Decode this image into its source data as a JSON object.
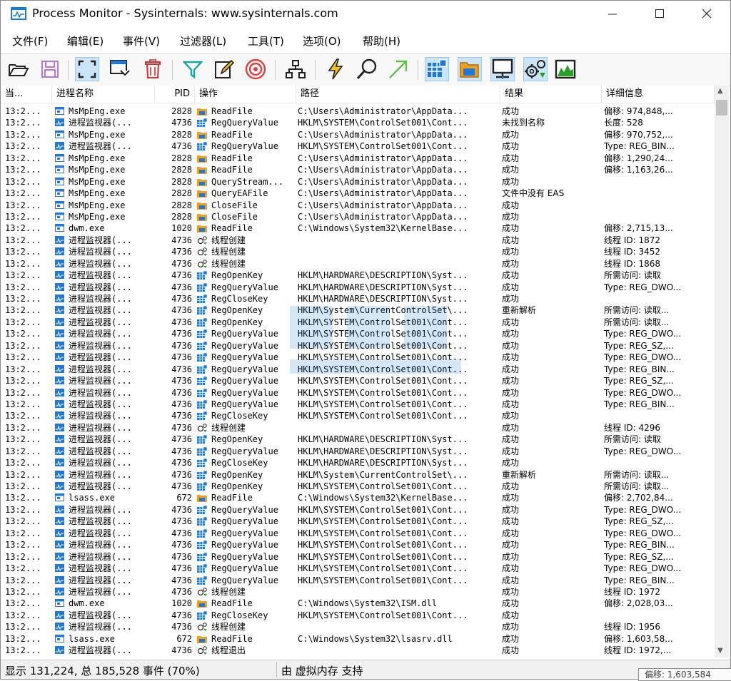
{
  "window": {
    "title": "Process Monitor - Sysinternals: www.sysinternals.com"
  },
  "menu": [
    "文件(F)",
    "编辑(E)",
    "事件(V)",
    "过滤器(L)",
    "工具(T)",
    "选项(O)",
    "帮助(H)"
  ],
  "toolbar": {
    "icons": [
      "open-folder-icon",
      "save-icon",
      "capture-icon",
      "autoscroll-icon",
      "clear-icon",
      "filter-icon",
      "highlight-icon",
      "include-target-icon",
      "process-tree-icon",
      "registry-activity-icon",
      "find-icon",
      "jump-to-icon",
      "show-registry-icon",
      "show-filesystem-icon",
      "show-network-icon",
      "show-process-icon",
      "show-profiling-icon"
    ]
  },
  "colors": {
    "highlight": "#cce4f7",
    "status_bg": "#f0f0f0",
    "blue_icon": "#1e78d7",
    "orange_icon": "#f0a020",
    "red_icon": "#d03030",
    "green_icon": "#2aa02a"
  },
  "columns": {
    "time": "当...",
    "process": "进程名称",
    "pid": "PID",
    "operation": "操作",
    "path": "路径",
    "result": "结果",
    "detail": "详细信息"
  },
  "rows": [
    {
      "time": "13:2...",
      "proc": "MsMpEng.exe",
      "pk": "exe",
      "pid": "2828",
      "op": "ReadFile",
      "ok": "file",
      "path": "C:\\Users\\Administrator\\AppData...",
      "res": "成功",
      "det": "偏移: 974,848,..."
    },
    {
      "time": "13:2...",
      "proc": "进程监视器(...",
      "pk": "pm",
      "pid": "4736",
      "op": "RegQueryValue",
      "ok": "reg",
      "path": "HKLM\\SYSTEM\\ControlSet001\\Cont...",
      "res": "未找到名称",
      "det": "长度: 528"
    },
    {
      "time": "13:2...",
      "proc": "MsMpEng.exe",
      "pk": "exe",
      "pid": "2828",
      "op": "ReadFile",
      "ok": "file",
      "path": "C:\\Users\\Administrator\\AppData...",
      "res": "成功",
      "det": "偏移: 970,752,..."
    },
    {
      "time": "13:2...",
      "proc": "进程监视器(...",
      "pk": "pm",
      "pid": "4736",
      "op": "RegQueryValue",
      "ok": "reg",
      "path": "HKLM\\SYSTEM\\ControlSet001\\Cont...",
      "res": "成功",
      "det": "Type: REG_BIN..."
    },
    {
      "time": "13:2...",
      "proc": "MsMpEng.exe",
      "pk": "exe",
      "pid": "2828",
      "op": "ReadFile",
      "ok": "file",
      "path": "C:\\Users\\Administrator\\AppData...",
      "res": "成功",
      "det": "偏移: 1,290,24..."
    },
    {
      "time": "13:2...",
      "proc": "MsMpEng.exe",
      "pk": "exe",
      "pid": "2828",
      "op": "ReadFile",
      "ok": "file",
      "path": "C:\\Users\\Administrator\\AppData...",
      "res": "成功",
      "det": "偏移: 1,163,26..."
    },
    {
      "time": "13:2...",
      "proc": "MsMpEng.exe",
      "pk": "exe",
      "pid": "2828",
      "op": "QueryStream...",
      "ok": "file",
      "path": "C:\\Users\\Administrator\\AppData...",
      "res": "成功",
      "det": ""
    },
    {
      "time": "13:2...",
      "proc": "MsMpEng.exe",
      "pk": "exe",
      "pid": "2828",
      "op": "QueryEAFile",
      "ok": "file",
      "path": "C:\\Users\\Administrator\\AppData...",
      "res": "文件中没有 EAS",
      "det": ""
    },
    {
      "time": "13:2...",
      "proc": "MsMpEng.exe",
      "pk": "exe",
      "pid": "2828",
      "op": "CloseFile",
      "ok": "file",
      "path": "C:\\Users\\Administrator\\AppData...",
      "res": "成功",
      "det": ""
    },
    {
      "time": "13:2...",
      "proc": "MsMpEng.exe",
      "pk": "exe",
      "pid": "2828",
      "op": "CloseFile",
      "ok": "file",
      "path": "C:\\Users\\Administrator\\AppData...",
      "res": "成功",
      "det": ""
    },
    {
      "time": "13:2...",
      "proc": "dwm.exe",
      "pk": "exe",
      "pid": "1020",
      "op": "ReadFile",
      "ok": "file",
      "path": "C:\\Windows\\System32\\KernelBase...",
      "res": "成功",
      "det": "偏移: 2,715,13..."
    },
    {
      "time": "13:2...",
      "proc": "进程监视器(...",
      "pk": "pm",
      "pid": "4736",
      "op": "线程创建",
      "ok": "thread",
      "path": "",
      "res": "成功",
      "det": "线程 ID: 1872"
    },
    {
      "time": "13:2...",
      "proc": "进程监视器(...",
      "pk": "pm",
      "pid": "4736",
      "op": "线程创建",
      "ok": "thread",
      "path": "",
      "res": "成功",
      "det": "线程 ID: 3452"
    },
    {
      "time": "13:2...",
      "proc": "进程监视器(...",
      "pk": "pm",
      "pid": "4736",
      "op": "线程创建",
      "ok": "thread",
      "path": "",
      "res": "成功",
      "det": "线程 ID: 1868"
    },
    {
      "time": "13:2...",
      "proc": "进程监视器(...",
      "pk": "pm",
      "pid": "4736",
      "op": "RegOpenKey",
      "ok": "reg",
      "path": "HKLM\\HARDWARE\\DESCRIPTION\\Syst...",
      "res": "成功",
      "det": "所需访问: 读取"
    },
    {
      "time": "13:2...",
      "proc": "进程监视器(...",
      "pk": "pm",
      "pid": "4736",
      "op": "RegQueryValue",
      "ok": "reg",
      "path": "HKLM\\HARDWARE\\DESCRIPTION\\Syst...",
      "res": "成功",
      "det": "Type: REG_DWO..."
    },
    {
      "time": "13:2...",
      "proc": "进程监视器(...",
      "pk": "pm",
      "pid": "4736",
      "op": "RegCloseKey",
      "ok": "reg",
      "path": "HKLM\\HARDWARE\\DESCRIPTION\\Syst...",
      "res": "成功",
      "det": ""
    },
    {
      "time": "13:2...",
      "proc": "进程监视器(...",
      "pk": "pm",
      "pid": "4736",
      "op": "RegOpenKey",
      "ok": "reg",
      "path": "HKLM\\System\\CurrentControlSet\\...",
      "res": "重新解析",
      "det": "所需访问: 读取..."
    },
    {
      "time": "13:2...",
      "proc": "进程监视器(...",
      "pk": "pm",
      "pid": "4736",
      "op": "RegOpenKey",
      "ok": "reg",
      "path": "HKLM\\SYSTEM\\ControlSet001\\Cont...",
      "res": "成功",
      "det": "所需访问: 读取..."
    },
    {
      "time": "13:2...",
      "proc": "进程监视器(...",
      "pk": "pm",
      "pid": "4736",
      "op": "RegQueryValue",
      "ok": "reg",
      "path": "HKLM\\SYSTEM\\ControlSet001\\Cont...",
      "res": "成功",
      "det": "Type: REG_DWO..."
    },
    {
      "time": "13:2...",
      "proc": "进程监视器(...",
      "pk": "pm",
      "pid": "4736",
      "op": "RegQueryValue",
      "ok": "reg",
      "path": "HKLM\\SYSTEM\\ControlSet001\\Cont...",
      "res": "成功",
      "det": "Type: REG_SZ,..."
    },
    {
      "time": "13:2...",
      "proc": "进程监视器(...",
      "pk": "pm",
      "pid": "4736",
      "op": "RegQueryValue",
      "ok": "reg",
      "path": "HKLM\\SYSTEM\\ControlSet001\\Cont...",
      "res": "成功",
      "det": "Type: REG_DWO..."
    },
    {
      "time": "13:2...",
      "proc": "进程监视器(...",
      "pk": "pm",
      "pid": "4736",
      "op": "RegQueryValue",
      "ok": "reg",
      "path": "HKLM\\SYSTEM\\ControlSet001\\Cont...",
      "res": "成功",
      "det": "Type: REG_BIN..."
    },
    {
      "time": "13:2...",
      "proc": "进程监视器(...",
      "pk": "pm",
      "pid": "4736",
      "op": "RegQueryValue",
      "ok": "reg",
      "path": "HKLM\\SYSTEM\\ControlSet001\\Cont...",
      "res": "成功",
      "det": "Type: REG_SZ,..."
    },
    {
      "time": "13:2...",
      "proc": "进程监视器(...",
      "pk": "pm",
      "pid": "4736",
      "op": "RegQueryValue",
      "ok": "reg",
      "path": "HKLM\\SYSTEM\\ControlSet001\\Cont...",
      "res": "成功",
      "det": "Type: REG_DWO..."
    },
    {
      "time": "13:2...",
      "proc": "进程监视器(...",
      "pk": "pm",
      "pid": "4736",
      "op": "RegQueryValue",
      "ok": "reg",
      "path": "HKLM\\SYSTEM\\ControlSet001\\Cont...",
      "res": "成功",
      "det": "Type: REG_BIN..."
    },
    {
      "time": "13:2...",
      "proc": "进程监视器(...",
      "pk": "pm",
      "pid": "4736",
      "op": "RegCloseKey",
      "ok": "reg",
      "path": "HKLM\\SYSTEM\\ControlSet001\\Cont...",
      "res": "成功",
      "det": ""
    },
    {
      "time": "13:2...",
      "proc": "进程监视器(...",
      "pk": "pm",
      "pid": "4736",
      "op": "线程创建",
      "ok": "thread",
      "path": "",
      "res": "成功",
      "det": "线程 ID: 4296"
    },
    {
      "time": "13:2...",
      "proc": "进程监视器(...",
      "pk": "pm",
      "pid": "4736",
      "op": "RegOpenKey",
      "ok": "reg",
      "path": "HKLM\\HARDWARE\\DESCRIPTION\\Syst...",
      "res": "成功",
      "det": "所需访问: 读取"
    },
    {
      "time": "13:2...",
      "proc": "进程监视器(...",
      "pk": "pm",
      "pid": "4736",
      "op": "RegQueryValue",
      "ok": "reg",
      "path": "HKLM\\HARDWARE\\DESCRIPTION\\Syst...",
      "res": "成功",
      "det": "Type: REG_DWO..."
    },
    {
      "time": "13:2...",
      "proc": "进程监视器(...",
      "pk": "pm",
      "pid": "4736",
      "op": "RegCloseKey",
      "ok": "reg",
      "path": "HKLM\\HARDWARE\\DESCRIPTION\\Syst...",
      "res": "成功",
      "det": ""
    },
    {
      "time": "13:2...",
      "proc": "进程监视器(...",
      "pk": "pm",
      "pid": "4736",
      "op": "RegOpenKey",
      "ok": "reg",
      "path": "HKLM\\System\\CurrentControlSet\\...",
      "res": "重新解析",
      "det": "所需访问: 读取..."
    },
    {
      "time": "13:2...",
      "proc": "进程监视器(...",
      "pk": "pm",
      "pid": "4736",
      "op": "RegOpenKey",
      "ok": "reg",
      "path": "HKLM\\SYSTEM\\ControlSet001\\Cont...",
      "res": "成功",
      "det": "所需访问: 读取..."
    },
    {
      "time": "13:2...",
      "proc": "lsass.exe",
      "pk": "exe",
      "pid": "672",
      "op": "ReadFile",
      "ok": "file",
      "path": "C:\\Windows\\System32\\KernelBase...",
      "res": "成功",
      "det": "偏移: 2,702,84..."
    },
    {
      "time": "13:2...",
      "proc": "进程监视器(...",
      "pk": "pm",
      "pid": "4736",
      "op": "RegQueryValue",
      "ok": "reg",
      "path": "HKLM\\SYSTEM\\ControlSet001\\Cont...",
      "res": "成功",
      "det": "Type: REG_DWO..."
    },
    {
      "time": "13:2...",
      "proc": "进程监视器(...",
      "pk": "pm",
      "pid": "4736",
      "op": "RegQueryValue",
      "ok": "reg",
      "path": "HKLM\\SYSTEM\\ControlSet001\\Cont...",
      "res": "成功",
      "det": "Type: REG_SZ,..."
    },
    {
      "time": "13:2...",
      "proc": "进程监视器(...",
      "pk": "pm",
      "pid": "4736",
      "op": "RegQueryValue",
      "ok": "reg",
      "path": "HKLM\\SYSTEM\\ControlSet001\\Cont...",
      "res": "成功",
      "det": "Type: REG_DWO..."
    },
    {
      "time": "13:2...",
      "proc": "进程监视器(...",
      "pk": "pm",
      "pid": "4736",
      "op": "RegQueryValue",
      "ok": "reg",
      "path": "HKLM\\SYSTEM\\ControlSet001\\Cont...",
      "res": "成功",
      "det": "Type: REG_BIN..."
    },
    {
      "time": "13:2...",
      "proc": "进程监视器(...",
      "pk": "pm",
      "pid": "4736",
      "op": "RegQueryValue",
      "ok": "reg",
      "path": "HKLM\\SYSTEM\\ControlSet001\\Cont...",
      "res": "成功",
      "det": "Type: REG_SZ,..."
    },
    {
      "time": "13:2...",
      "proc": "进程监视器(...",
      "pk": "pm",
      "pid": "4736",
      "op": "RegQueryValue",
      "ok": "reg",
      "path": "HKLM\\SYSTEM\\ControlSet001\\Cont...",
      "res": "成功",
      "det": "Type: REG_DWO..."
    },
    {
      "time": "13:2...",
      "proc": "进程监视器(...",
      "pk": "pm",
      "pid": "4736",
      "op": "RegQueryValue",
      "ok": "reg",
      "path": "HKLM\\SYSTEM\\ControlSet001\\Cont...",
      "res": "成功",
      "det": "Type: REG_BIN..."
    },
    {
      "time": "13:2...",
      "proc": "进程监视器(...",
      "pk": "pm",
      "pid": "4736",
      "op": "线程创建",
      "ok": "thread",
      "path": "",
      "res": "成功",
      "det": "线程 ID: 1972"
    },
    {
      "time": "13:2...",
      "proc": "dwm.exe",
      "pk": "exe",
      "pid": "1020",
      "op": "ReadFile",
      "ok": "file",
      "path": "C:\\Windows\\System32\\ISM.dll",
      "res": "成功",
      "det": "偏移: 2,028,03..."
    },
    {
      "time": "13:2...",
      "proc": "进程监视器(...",
      "pk": "pm",
      "pid": "4736",
      "op": "RegCloseKey",
      "ok": "reg",
      "path": "HKLM\\SYSTEM\\ControlSet001\\Cont...",
      "res": "成功",
      "det": ""
    },
    {
      "time": "13:2...",
      "proc": "进程监视器(...",
      "pk": "pm",
      "pid": "4736",
      "op": "线程创建",
      "ok": "thread",
      "path": "",
      "res": "成功",
      "det": "线程 ID: 1956"
    },
    {
      "time": "13:2...",
      "proc": "lsass.exe",
      "pk": "exe",
      "pid": "672",
      "op": "ReadFile",
      "ok": "file",
      "path": "C:\\Windows\\System32\\lsasrv.dll",
      "res": "成功",
      "det": "偏移: 1,603,58..."
    },
    {
      "time": "13:2...",
      "proc": "进程监视器(...",
      "pk": "pm",
      "pid": "4736",
      "op": "线程退出",
      "ok": "thread",
      "path": "",
      "res": "成功",
      "det": "线程 ID: 1972,..."
    }
  ],
  "status": {
    "left": "显示 131,224, 总 185,528 事件 (70%)",
    "right": "由 虚拟内存 支持"
  },
  "tooltip": "偏移: 1,603,584"
}
